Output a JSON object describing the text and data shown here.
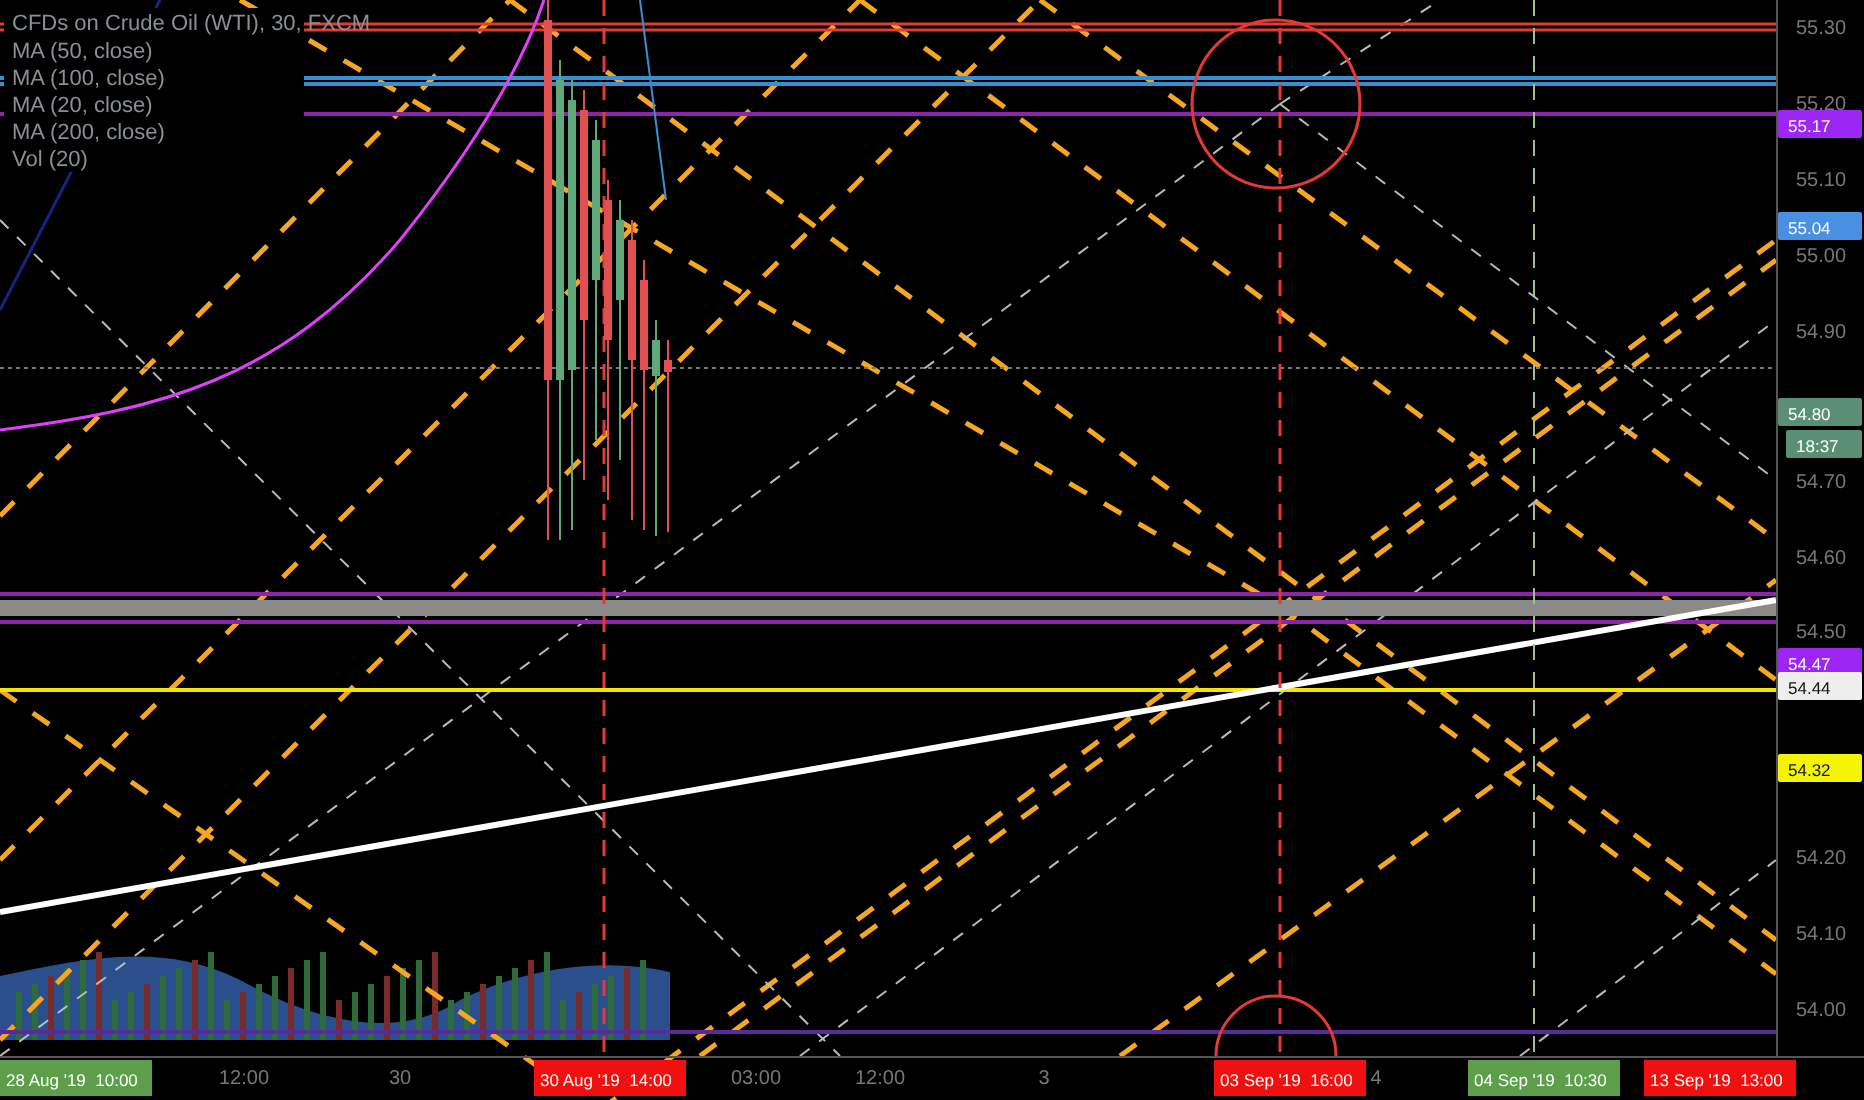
{
  "legend": {
    "title": "CFDs on Crude Oil (WTI), 30, FXCM",
    "indicators": [
      "MA (50, close)",
      "MA (100, close)",
      "MA (20, close)",
      "MA (200, close)",
      "Vol (20)"
    ]
  },
  "price_axis": {
    "ticks": [
      "55.30",
      "55.20",
      "55.10",
      "55.00",
      "54.90",
      "54.70",
      "54.60",
      "54.50",
      "54.20",
      "54.10",
      "54.00"
    ],
    "labels": [
      {
        "text": "55.17",
        "color": "#9c27f5"
      },
      {
        "text": "55.04",
        "color": "#4a90e2"
      },
      {
        "text": "54.80",
        "color": "#5b8f75"
      },
      {
        "text": "18:37",
        "color": "#5b8f75"
      },
      {
        "text": "54.47",
        "color": "#9c27f5"
      },
      {
        "text": "54.44",
        "color": "#eeeeee"
      },
      {
        "text": "54.32",
        "color": "#f5f500"
      }
    ]
  },
  "time_axis": {
    "ticks": [
      "12:00",
      "30",
      "03:00",
      "12:00",
      "3",
      "4"
    ],
    "labels": [
      {
        "date": "28 Aug '19",
        "time": "10:00",
        "color": "#5d9e4a"
      },
      {
        "date": "30 Aug '19",
        "time": "14:00",
        "color": "#f01010"
      },
      {
        "date": "03 Sep '19",
        "time": "16:00",
        "color": "#f01010"
      },
      {
        "date": "04 Sep '19",
        "time": "10:30",
        "color": "#5d9e4a"
      },
      {
        "date": "13 Sep '19",
        "time": "13:00",
        "color": "#f01010"
      }
    ]
  }
}
